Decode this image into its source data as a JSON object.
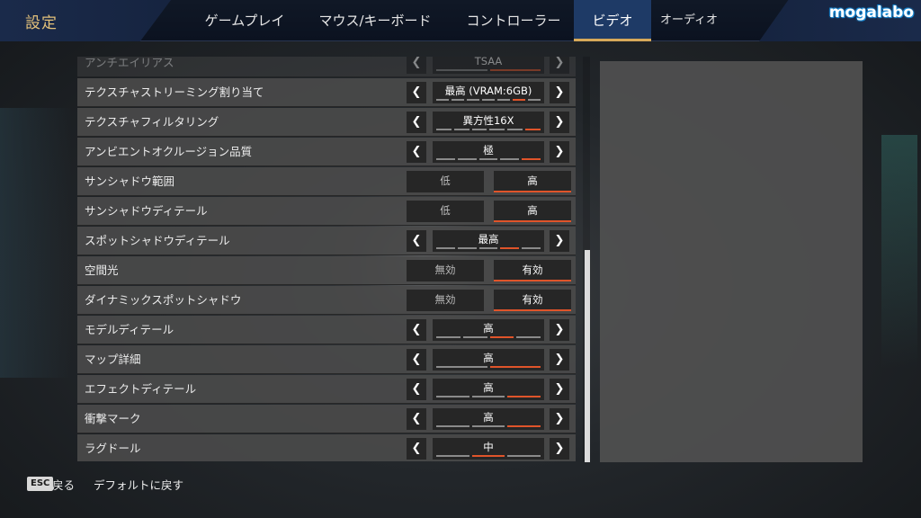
{
  "header": {
    "title": "設定",
    "brand": "mogalabo",
    "tabs": [
      {
        "label": "ゲームプレイ"
      },
      {
        "label": "マウス/キーボード"
      },
      {
        "label": "コントローラー"
      },
      {
        "label": "ビデオ",
        "active": true
      },
      {
        "label": "オーディオ"
      }
    ]
  },
  "settings": [
    {
      "label": "アンチエイリアス",
      "kind": "selector",
      "value": "TSAA",
      "segments": 2,
      "active_segment": 2
    },
    {
      "label": "テクスチャストリーミング割り当て",
      "kind": "selector",
      "value": "最高 (VRAM:6GB)",
      "segments": 7,
      "active_segment": 6
    },
    {
      "label": "テクスチャフィルタリング",
      "kind": "selector",
      "value": "異方性16X",
      "segments": 6,
      "active_segment": 6
    },
    {
      "label": "アンビエントオクルージョン品質",
      "kind": "selector",
      "value": "極",
      "segments": 5,
      "active_segment": 5
    },
    {
      "label": "サンシャドウ範囲",
      "kind": "toggle",
      "options": [
        "低",
        "高"
      ],
      "active_option": 1
    },
    {
      "label": "サンシャドウディテール",
      "kind": "toggle",
      "options": [
        "低",
        "高"
      ],
      "active_option": 1
    },
    {
      "label": "スポットシャドウディテール",
      "kind": "selector",
      "value": "最高",
      "segments": 5,
      "active_segment": 4
    },
    {
      "label": "空間光",
      "kind": "toggle",
      "options": [
        "無効",
        "有効"
      ],
      "active_option": 1
    },
    {
      "label": "ダイナミックスポットシャドウ",
      "kind": "toggle",
      "options": [
        "無効",
        "有効"
      ],
      "active_option": 1
    },
    {
      "label": "モデルディテール",
      "kind": "selector",
      "value": "高",
      "segments": 4,
      "active_segment": 3
    },
    {
      "label": "マップ詳細",
      "kind": "selector",
      "value": "高",
      "segments": 2,
      "active_segment": 2
    },
    {
      "label": "エフェクトディテール",
      "kind": "selector",
      "value": "高",
      "segments": 3,
      "active_segment": 3
    },
    {
      "label": "衝撃マーク",
      "kind": "selector",
      "value": "高",
      "segments": 3,
      "active_segment": 3
    },
    {
      "label": "ラグドール",
      "kind": "selector",
      "value": "中",
      "segments": 3,
      "active_segment": 2
    }
  ],
  "footer": {
    "esc_key": "ESC",
    "back_label": "戻る",
    "reset_label": "デフォルトに戻す"
  },
  "colors": {
    "accent": "#e0542a",
    "title_gold": "#e2c07a",
    "tab_active": "#1e3a66"
  }
}
